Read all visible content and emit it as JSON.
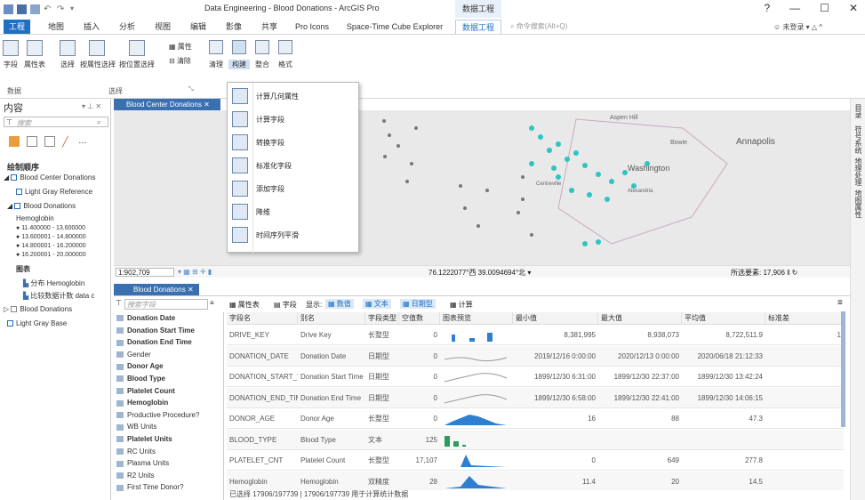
{
  "window": {
    "title": "Data Engineering - Blood Donations - ArcGIS Pro",
    "context_tab_group": "数据工程",
    "controls": [
      "?",
      "—",
      "☐",
      "✕"
    ]
  },
  "tabs": [
    {
      "label": "工程"
    },
    {
      "label": "地图"
    },
    {
      "label": "插入"
    },
    {
      "label": "分析"
    },
    {
      "label": "视图"
    },
    {
      "label": "编辑"
    },
    {
      "label": "影像"
    },
    {
      "label": "共享"
    },
    {
      "label": "Pro Icons"
    },
    {
      "label": "Space-Time Cube Explorer"
    },
    {
      "label": "数据工程"
    }
  ],
  "search": {
    "placeholder": "命令搜索(Alt+Q)"
  },
  "user": {
    "label": "未登录"
  },
  "ribbon": {
    "buttons": [
      "字段",
      "属性表",
      "选择",
      "按属性选择",
      "按位置选择",
      "属性",
      "清除",
      "清理",
      "构建",
      "整合",
      "格式"
    ],
    "groups": [
      "数据",
      "选择"
    ]
  },
  "contents": {
    "title": "内容",
    "search_placeholder": "搜索",
    "drawing_order": "绘制顺序",
    "layers": {
      "map": "Blood Center Donations",
      "basemap_ref": "Light Gray Reference",
      "blood_donations": "Blood Donations",
      "field": "Hemoglobin",
      "classes": [
        "11.400000 - 13.600000",
        "13.600001 - 14.800000",
        "14.800001 - 16.200000",
        "16.200001 - 20.000000"
      ],
      "charts_heading": "图表",
      "chart1": "分布 Hemoglobin",
      "chart2": "比较数据计数 data c",
      "blood_donations2": "Blood Donations",
      "basemap": "Light Gray Base"
    }
  },
  "map": {
    "tab": "Blood Center Donations",
    "scale": "1:902,709",
    "coords": "76.1222077°西 39.0094694°北",
    "selected": "所选要素: 17,906",
    "labels": {
      "aspen": "Aspen Hill",
      "bowie": "Bowie",
      "annapolis": "Annapolis",
      "washington": "Washington",
      "alexandria": "Alexandria",
      "centreville": "Centreville"
    }
  },
  "dropdown": {
    "items": [
      "计算几何属性",
      "计算字段",
      "转换字段",
      "标准化字段",
      "添加字段",
      "降维",
      "时间序列平滑"
    ]
  },
  "right_strip": [
    "目录",
    "符号系统",
    "地理处理",
    "地图属性"
  ],
  "table": {
    "tab": "Blood Donations",
    "search_placeholder": "搜索字段",
    "toolbar": [
      "属性表",
      "字段",
      "显示:",
      "数值",
      "文本",
      "日期型",
      "计算"
    ],
    "fields": [
      {
        "name": "Donation Date",
        "bold": true
      },
      {
        "name": "Donation Start Time",
        "bold": true
      },
      {
        "name": "Donation End Time",
        "bold": true
      },
      {
        "name": "Gender",
        "bold": false
      },
      {
        "name": "Donor Age",
        "bold": true
      },
      {
        "name": "Blood Type",
        "bold": true
      },
      {
        "name": "Platelet Count",
        "bold": true
      },
      {
        "name": "Hemoglobin",
        "bold": true
      },
      {
        "name": "Productive Procedure?",
        "bold": false
      },
      {
        "name": "WB Units",
        "bold": false
      },
      {
        "name": "Platelet Units",
        "bold": true
      },
      {
        "name": "RC Units",
        "bold": false
      },
      {
        "name": "Plasma Units",
        "bold": false
      },
      {
        "name": "R2 Units",
        "bold": false
      },
      {
        "name": "First Time Donor?",
        "bold": false
      }
    ],
    "columns": [
      "字段名",
      "别名",
      "字段类型",
      "空值数",
      "图表预览",
      "最小值",
      "最大值",
      "平均值",
      "标准差"
    ],
    "rows": [
      {
        "name": "DRIVE_KEY",
        "alias": "Drive Key",
        "type": "长整型",
        "nulls": "0",
        "min": "8,381,995",
        "max": "8,938,073",
        "mean": "8,722,511.9",
        "std": "1"
      },
      {
        "name": "DONATION_DATE",
        "alias": "Donation Date",
        "type": "日期型",
        "nulls": "0",
        "min": "2019/12/16 0:00:00",
        "max": "2020/12/13 0:00:00",
        "mean": "2020/06/18 21:12:33",
        "std": ""
      },
      {
        "name": "DONATION_START_TIME",
        "alias": "Donation Start Time",
        "type": "日期型",
        "nulls": "0",
        "min": "1899/12/30 6:31:00",
        "max": "1899/12/30 22:37:00",
        "mean": "1899/12/30 13:42:24",
        "std": ""
      },
      {
        "name": "DONATION_END_TIME",
        "alias": "Donation End Time",
        "type": "日期型",
        "nulls": "0",
        "min": "1899/12/30 6:58:00",
        "max": "1899/12/30 22:41:00",
        "mean": "1899/12/30 14:06:15",
        "std": ""
      },
      {
        "name": "DONOR_AGE",
        "alias": "Donor Age",
        "type": "长整型",
        "nulls": "0",
        "min": "16",
        "max": "88",
        "mean": "47.3",
        "std": ""
      },
      {
        "name": "BLOOD_TYPE",
        "alias": "Blood Type",
        "type": "文本",
        "nulls": "125",
        "min": "",
        "max": "",
        "mean": "",
        "std": ""
      },
      {
        "name": "PLATELET_CNT",
        "alias": "Platelet Count",
        "type": "长整型",
        "nulls": "17,107",
        "min": "0",
        "max": "649",
        "mean": "277.8",
        "std": ""
      },
      {
        "name": "Hemoglobin",
        "alias": "Hemoglobin",
        "type": "双精度",
        "nulls": "28",
        "min": "11.4",
        "max": "20",
        "mean": "14.5",
        "std": ""
      }
    ],
    "status": "已选择 17906/197739 | 17906/197739 用于计算统计数据"
  },
  "colors": {
    "accent": "#1f6fc5",
    "points": "#2ec4c0",
    "tab": "#3a6fb0"
  }
}
